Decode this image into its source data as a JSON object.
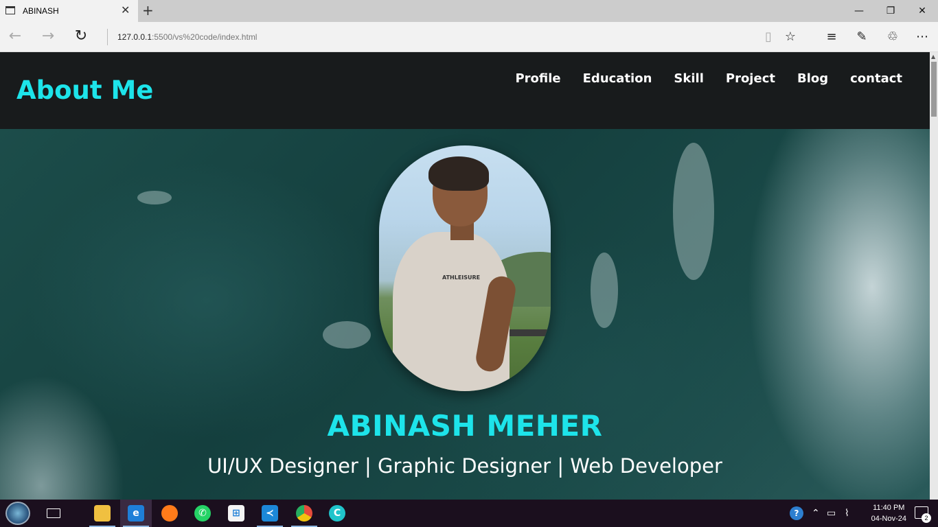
{
  "browser": {
    "tab_title": "ABINASH",
    "new_tab_label": "+",
    "address_host": "127.0.0.1",
    "address_path": ":5500/vs%20code/index.html",
    "window_controls": [
      "minimize-icon",
      "restore-icon",
      "close-icon"
    ],
    "toolbar_icons": [
      "reading-view-icon",
      "favorite-star-icon",
      "hub-icon",
      "web-note-icon",
      "share-icon",
      "more-icon"
    ]
  },
  "site": {
    "brand": "About Me",
    "menu": [
      {
        "label": "Profile"
      },
      {
        "label": "Education"
      },
      {
        "label": "Skill"
      },
      {
        "label": "Project"
      },
      {
        "label": "Blog"
      },
      {
        "label": "contact"
      }
    ],
    "hero": {
      "name": "ABINASH MEHER",
      "role": "UI/UX Designer | Graphic Designer | Web Developer",
      "photo_shirt_text": "ATHLEISURE"
    },
    "colors": {
      "accent": "#1de4ea",
      "header_bg": "#181b1c"
    }
  },
  "taskbar": {
    "apps": [
      "task-view-icon",
      "file-explorer-icon",
      "edge-icon",
      "firefox-icon",
      "whatsapp-icon",
      "store-icon",
      "vscode-icon",
      "chrome-icon",
      "canva-icon"
    ],
    "time": "11:40 PM",
    "date": "04-Nov-24",
    "notification_count": "2"
  }
}
